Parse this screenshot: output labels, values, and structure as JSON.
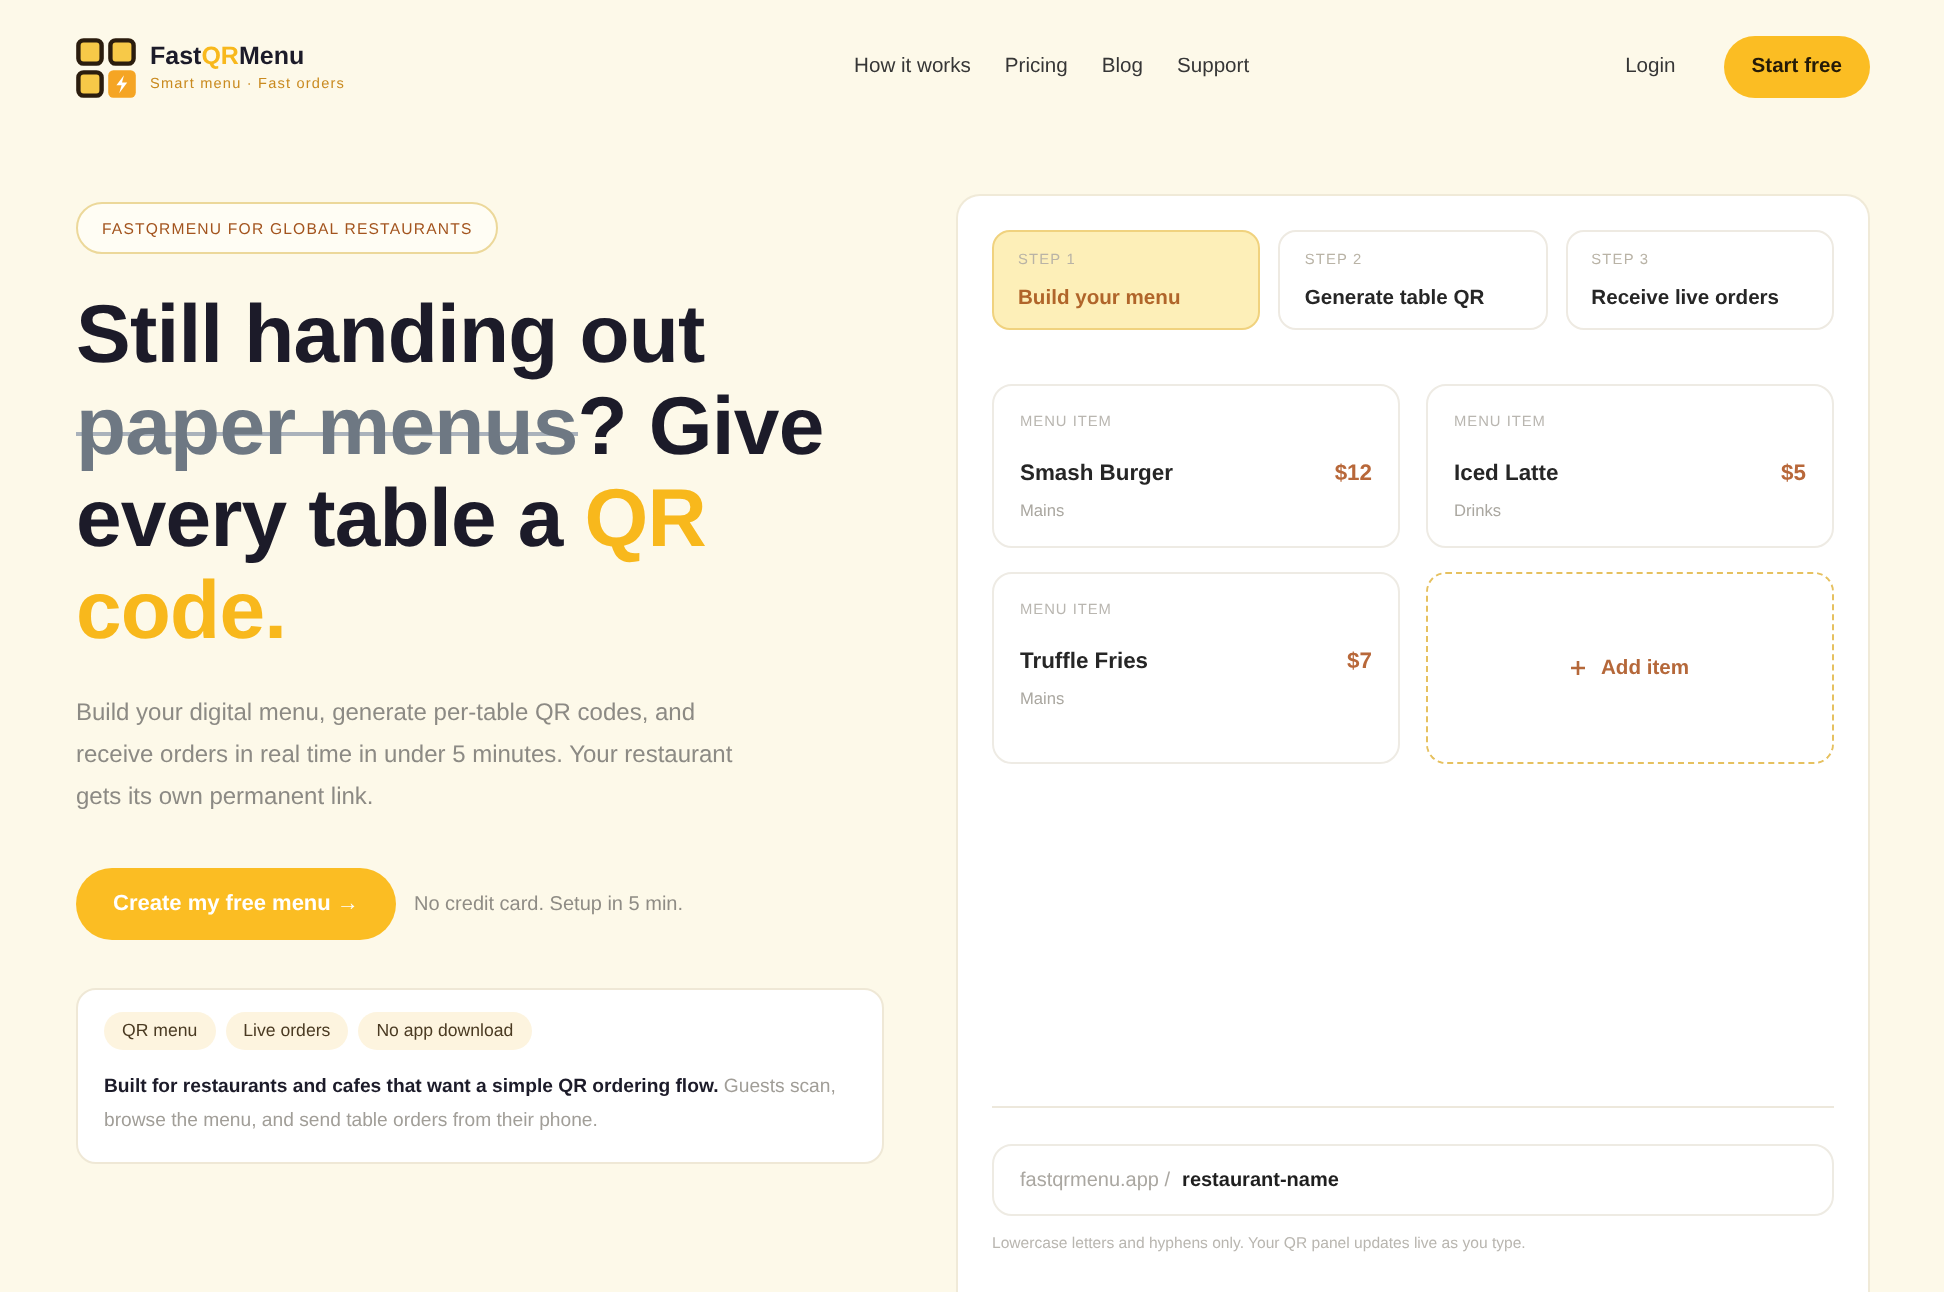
{
  "header": {
    "brand": {
      "name_parts": [
        {
          "text": "Fast",
          "kind": "plain"
        },
        {
          "text": "QR",
          "kind": "accent"
        },
        {
          "text": "Menu",
          "kind": "plain"
        }
      ],
      "tagline": "Smart menu · Fast orders"
    },
    "nav": [
      "How it works",
      "Pricing",
      "Blog",
      "Support"
    ],
    "login": "Login",
    "cta": "Start free"
  },
  "hero": {
    "badge": "FASTQRMENU FOR GLOBAL RESTAURANTS",
    "headline": [
      {
        "text": "Still handing out ",
        "kind": "plain"
      },
      {
        "text": "paper menus",
        "kind": "struck"
      },
      {
        "text": "? Give every table a ",
        "kind": "plain"
      },
      {
        "text": "QR code.",
        "kind": "accent"
      }
    ],
    "description": "Build your digital menu, generate per-table QR codes, and receive orders in real time in under 5 minutes. Your restaurant gets its own permanent link.",
    "cta": "Create my free menu →",
    "cta_note": "No credit card. Setup in 5 min.",
    "info": {
      "tags": [
        "QR menu",
        "Live orders",
        "No app download"
      ],
      "text": "**Built for restaurants and cafes that want a simple QR ordering flow.** Guests scan, browse the menu, and send table orders from their phone."
    }
  },
  "panel": {
    "steps": [
      {
        "label": "STEP 1",
        "title": "Build your menu",
        "selected": true
      },
      {
        "label": "STEP 2",
        "title": "Generate table QR",
        "selected": false
      },
      {
        "label": "STEP 3",
        "title": "Receive live orders",
        "selected": false
      }
    ],
    "menu_items": [
      {
        "label": "MENU ITEM",
        "name": "Smash Burger",
        "price": "$12",
        "category": "Mains"
      },
      {
        "label": "MENU ITEM",
        "name": "Iced Latte",
        "price": "$5",
        "category": "Drinks"
      },
      {
        "label": "MENU ITEM",
        "name": "Truffle Fries",
        "price": "$7",
        "category": "Mains"
      }
    ],
    "add_item": "Add item",
    "url": {
      "prefix": "fastqrmenu.app /",
      "value": "restaurant-name"
    },
    "hint": "Lowercase letters and hyphens only. Your QR panel updates live as you type."
  }
}
